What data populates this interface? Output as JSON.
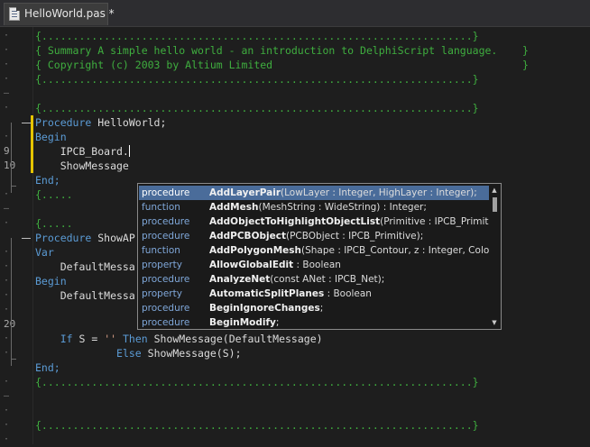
{
  "tab": {
    "label": "HelloWorld.pas *"
  },
  "editor": {
    "lines": [
      {
        "gutter": "dot",
        "segs": [
          {
            "cls": "c-comment",
            "text": "{.....................................................................}"
          }
        ]
      },
      {
        "gutter": "dot",
        "segs": [
          {
            "cls": "c-comment",
            "text": "{ Summary A simple hello world - an introduction to DelphiScript language.    }"
          }
        ]
      },
      {
        "gutter": "dot",
        "segs": [
          {
            "cls": "c-comment",
            "text": "{ Copyright (c) 2003 by Altium Limited                                        }"
          }
        ]
      },
      {
        "gutter": "dot",
        "segs": [
          {
            "cls": "c-comment",
            "text": "{.....................................................................}"
          }
        ]
      },
      {
        "gutter": "dash",
        "segs": []
      },
      {
        "gutter": "dot",
        "segs": [
          {
            "cls": "c-comment",
            "text": "{.....................................................................}"
          }
        ]
      },
      {
        "gutter": "",
        "segs": [
          {
            "cls": "c-kw",
            "text": "Procedure"
          },
          {
            "cls": "c-text",
            "text": " HelloWorld;"
          }
        ]
      },
      {
        "gutter": "dot",
        "segs": [
          {
            "cls": "c-kw",
            "text": "Begin"
          }
        ]
      },
      {
        "gutter": "num",
        "num": "9",
        "segs": [
          {
            "cls": "c-text",
            "text": "    IPCB_Board."
          }
        ],
        "caret": true
      },
      {
        "gutter": "num",
        "num": "10",
        "segs": [
          {
            "cls": "c-text",
            "text": "    ShowMessage"
          }
        ]
      },
      {
        "gutter": "",
        "segs": [
          {
            "cls": "c-kw",
            "text": "End;"
          }
        ]
      },
      {
        "gutter": "dot",
        "segs": [
          {
            "cls": "c-comment",
            "text": "{....."
          }
        ]
      },
      {
        "gutter": "dash",
        "segs": []
      },
      {
        "gutter": "dot",
        "segs": [
          {
            "cls": "c-comment",
            "text": "{....."
          }
        ]
      },
      {
        "gutter": "",
        "segs": [
          {
            "cls": "c-kw",
            "text": "Procedure"
          },
          {
            "cls": "c-text",
            "text": " ShowAP"
          }
        ]
      },
      {
        "gutter": "dot",
        "segs": [
          {
            "cls": "c-kw",
            "text": "Var"
          }
        ]
      },
      {
        "gutter": "dot",
        "segs": [
          {
            "cls": "c-text",
            "text": "    DefaultMessa"
          }
        ]
      },
      {
        "gutter": "dot",
        "segs": [
          {
            "cls": "c-kw",
            "text": "Begin"
          }
        ]
      },
      {
        "gutter": "dot",
        "segs": [
          {
            "cls": "c-text",
            "text": "    DefaultMessa"
          }
        ]
      },
      {
        "gutter": "dot",
        "segs": []
      },
      {
        "gutter": "num",
        "num": "20",
        "segs": []
      },
      {
        "gutter": "dot",
        "segs": [
          {
            "cls": "c-text",
            "text": "    "
          },
          {
            "cls": "c-kw",
            "text": "If"
          },
          {
            "cls": "c-text",
            "text": " S = "
          },
          {
            "cls": "c-str",
            "text": "''"
          },
          {
            "cls": "c-text",
            "text": " "
          },
          {
            "cls": "c-kw",
            "text": "Then"
          },
          {
            "cls": "c-text",
            "text": " ShowMessage(DefaultMessage)"
          }
        ]
      },
      {
        "gutter": "dot",
        "segs": [
          {
            "cls": "c-text",
            "text": "             "
          },
          {
            "cls": "c-kw",
            "text": "Else"
          },
          {
            "cls": "c-text",
            "text": " ShowMessage(S);"
          }
        ]
      },
      {
        "gutter": "",
        "segs": [
          {
            "cls": "c-kw",
            "text": "End;"
          }
        ]
      },
      {
        "gutter": "dot",
        "segs": [
          {
            "cls": "c-comment",
            "text": "{.....................................................................}"
          }
        ]
      },
      {
        "gutter": "dash",
        "segs": []
      },
      {
        "gutter": "dot",
        "segs": []
      },
      {
        "gutter": "dot",
        "segs": [
          {
            "cls": "c-comment",
            "text": "{.....................................................................}"
          }
        ]
      },
      {
        "gutter": "dot",
        "segs": []
      }
    ]
  },
  "completion": {
    "selected_index": 0,
    "items": [
      {
        "kind": "procedure",
        "name": "AddLayerPair",
        "params": "(LowLayer : Integer, HighLayer : Integer);"
      },
      {
        "kind": "function",
        "name": "AddMesh",
        "params": "(MeshString : WideString) : Integer;"
      },
      {
        "kind": "procedure",
        "name": "AddObjectToHighlightObjectList",
        "params": "(Primitive : IPCB_Primitive)"
      },
      {
        "kind": "procedure",
        "name": "AddPCBObject",
        "params": "(PCBObject : IPCB_Primitive);"
      },
      {
        "kind": "function",
        "name": "AddPolygonMesh",
        "params": "(Shape : IPCB_Contour, z : Integer, Color :"
      },
      {
        "kind": "property",
        "name": "AllowGlobalEdit",
        "params": " : Boolean"
      },
      {
        "kind": "procedure",
        "name": "AnalyzeNet",
        "params": "(const ANet : IPCB_Net);"
      },
      {
        "kind": "property",
        "name": "AutomaticSplitPlanes",
        "params": " : Boolean"
      },
      {
        "kind": "procedure",
        "name": "BeginIgnoreChanges",
        "params": ";"
      },
      {
        "kind": "procedure",
        "name": "BeginModify",
        "params": ";"
      }
    ]
  },
  "colors": {
    "background": "#1e1e1e",
    "comment": "#3fae3f",
    "keyword": "#5b9bd5",
    "string": "#d69d85",
    "selection": "#4a6c9a",
    "changebar": "#e5c400"
  },
  "icons": {
    "tab_icon": "file-icon",
    "scroll_up": "arrow-up-icon",
    "scroll_down": "arrow-down-icon"
  }
}
